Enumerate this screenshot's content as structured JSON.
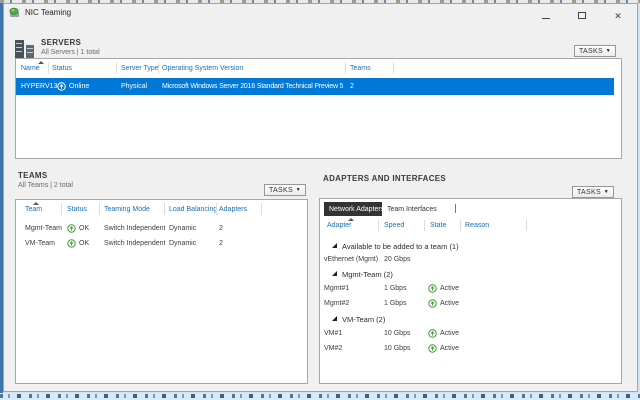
{
  "window": {
    "title": "NIC Teaming"
  },
  "icons": {
    "dropdown_arrow": "▼",
    "close": "✕",
    "sort_ascending": "▲",
    "group_expanded": "◢",
    "status_up_arrow": "↑"
  },
  "colors": {
    "selection_blue": "#0078d7",
    "column_header_blue": "#1a6fb5",
    "status_green": "#3f9c35",
    "active_tab_bg": "#333333",
    "window_bg": "#f0f0f0"
  },
  "servers": {
    "heading": "SERVERS",
    "subheading": "All Servers | 1 total",
    "tasks_label": "TASKS",
    "columns": [
      "Name",
      "Status",
      "Server Type",
      "Operating System Version",
      "Teams"
    ],
    "rows": [
      {
        "name": "HYPERV13",
        "status": "Online",
        "server_type": "Physical",
        "os_version": "Microsoft Windows Server 2016 Standard Technical Preview 5",
        "teams": "2"
      }
    ]
  },
  "teams": {
    "heading": "TEAMS",
    "subheading": "All Teams | 2 total",
    "tasks_label": "TASKS",
    "columns": [
      "Team",
      "Status",
      "Teaming Mode",
      "Load Balancing",
      "Adapters"
    ],
    "rows": [
      {
        "team": "Mgmt-Team",
        "status": "OK",
        "teaming_mode": "Switch Independent",
        "load_balancing": "Dynamic",
        "adapters": "2"
      },
      {
        "team": "VM-Team",
        "status": "OK",
        "teaming_mode": "Switch Independent",
        "load_balancing": "Dynamic",
        "adapters": "2"
      }
    ]
  },
  "adapters": {
    "heading": "ADAPTERS AND INTERFACES",
    "tasks_label": "TASKS",
    "tabs": [
      {
        "label": "Network Adapters"
      },
      {
        "label": "Team Interfaces"
      }
    ],
    "columns": [
      "Adapter",
      "Speed",
      "State",
      "Reason"
    ],
    "groups": [
      {
        "label": "Available to be added to a team (1)",
        "rows": [
          {
            "adapter": "vEthernet (Mgmt)",
            "speed": "20 Gbps",
            "state": "",
            "reason": ""
          }
        ]
      },
      {
        "label": "Mgmt-Team (2)",
        "rows": [
          {
            "adapter": "Mgmt#1",
            "speed": "1 Gbps",
            "state": "Active",
            "reason": ""
          },
          {
            "adapter": "Mgmt#2",
            "speed": "1 Gbps",
            "state": "Active",
            "reason": ""
          }
        ]
      },
      {
        "label": "VM-Team (2)",
        "rows": [
          {
            "adapter": "VM#1",
            "speed": "10 Gbps",
            "state": "Active",
            "reason": ""
          },
          {
            "adapter": "VM#2",
            "speed": "10 Gbps",
            "state": "Active",
            "reason": ""
          }
        ]
      }
    ]
  }
}
